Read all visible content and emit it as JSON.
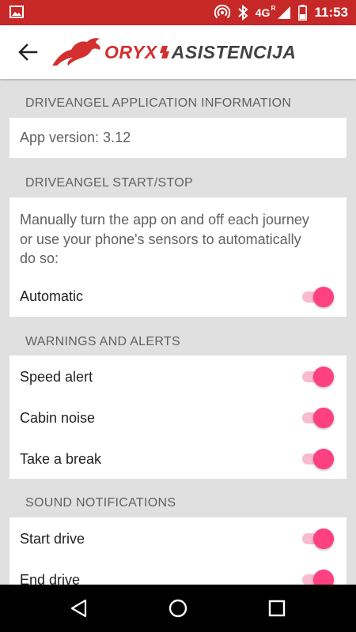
{
  "status_bar": {
    "network": "4G",
    "network_sub": "R",
    "time": "11:53",
    "icons": [
      "image-icon",
      "hotspot-icon",
      "bluetooth-icon",
      "signal-icon",
      "battery-icon"
    ]
  },
  "app_bar": {
    "logo_brand": "ORYX",
    "logo_sub": "ASISTENCIJA",
    "back_icon": "arrow-left-icon"
  },
  "sections": {
    "info": {
      "header": "DRIVEANGEL APPLICATION INFORMATION",
      "app_version": "App version: 3.12"
    },
    "start_stop": {
      "header": "DRIVEANGEL START/STOP",
      "description": "Manually turn the app on and off each journey or use your phone's sensors to automatically do so:",
      "automatic_label": "Automatic",
      "automatic_on": true
    },
    "warnings": {
      "header": "WARNINGS AND ALERTS",
      "items": [
        {
          "label": "Speed alert",
          "on": true
        },
        {
          "label": "Cabin noise",
          "on": true
        },
        {
          "label": "Take a break",
          "on": true
        }
      ]
    },
    "sound": {
      "header": "SOUND NOTIFICATIONS",
      "items": [
        {
          "label": "Start drive",
          "on": true
        },
        {
          "label": "End drive",
          "on": true
        }
      ]
    }
  },
  "colors": {
    "status_bar": "#c62828",
    "accent": "#ff4081",
    "accent_track": "#f8bbd0",
    "brand_red": "#d32f2f"
  }
}
